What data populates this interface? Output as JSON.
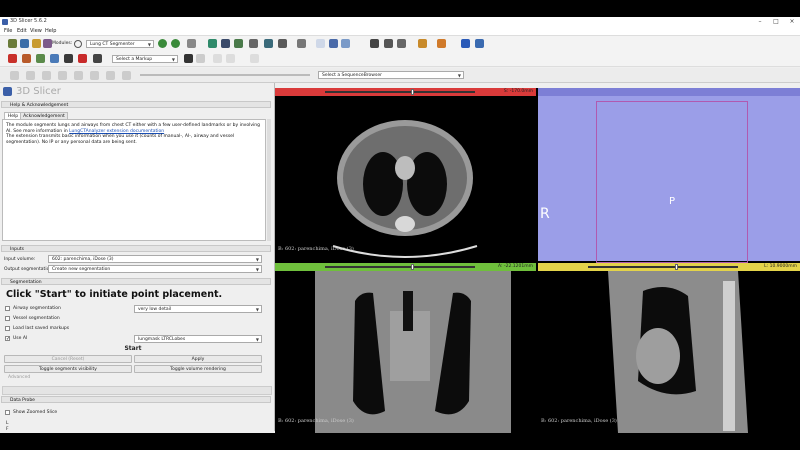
{
  "window": {
    "title": "3D Slicer 5.6.2"
  },
  "menu": [
    "File",
    "Edit",
    "View",
    "Help"
  ],
  "toolbar": {
    "modules_label": "Modules:",
    "module_selected": "Lung CT Segmenter",
    "markup_selected": "Select a Markup",
    "sequence_selected": "Select a SequenceBrowser"
  },
  "panel": {
    "logo_text": "3D Slicer",
    "help_section": "Help & Acknowledgement",
    "tabs": [
      "Help",
      "Acknowledgement"
    ],
    "help_text_1": "The module segments lungs and airways from chest CT either with a few user-defined landmarks or by involving AI. See more information in",
    "help_link": "LungCTAnalyzer extension documentation",
    "help_text_2": "The extension transmits basic information when you use it (counts of manual-, AI-, airway and vessel segmentation). No IP or any personal data are being sent.",
    "inputs_section": "Inputs",
    "input_volume_label": "Input volume:",
    "input_volume_value": "602: parenchima, iDose (3)",
    "output_seg_label": "Output segmentation:",
    "output_seg_value": "Create new segmentation",
    "segmentation_section": "Segmentation",
    "start_prompt": "Click \"Start\" to initiate point placement.",
    "airway_label": "Airway segmentation",
    "airway_value": "very low detail",
    "vessel_label": "Vessel segmentation",
    "load_last_label": "Load last saved markups",
    "use_ai_label": "Use AI",
    "ai_model_value": "lungmask LTRCLobes",
    "start_button": "Start",
    "cancel_button": "Cancel (Reset)",
    "apply_button": "Apply",
    "toggle_vis_button": "Toggle segments visibility",
    "toggle_render_button": "Toggle volume rendering",
    "advanced_label": "Advanced",
    "data_probe_section": "Data Probe",
    "show_zoomed_label": "Show Zoomed Slice",
    "probe_lines": [
      "L",
      "F",
      "B"
    ]
  },
  "views": {
    "red_annotation": "S: -170.0mm",
    "green_annotation": "A: -22.1201mm",
    "yellow_annotation": "L: 10.9000mm",
    "red_bottom_label": "B: 602: parenchima, iDose (3)",
    "green_bottom_label": "B: 602: parenchima, iDose (3)",
    "yellow_bottom_label": "B: 602: parenchima, iDose (3)",
    "threed_left_letter": "R",
    "threed_center_letter": "P"
  },
  "colors": {
    "red_bar": "#d93a3a",
    "green_bar": "#6fbf3c",
    "yellow_bar": "#e3d34a",
    "threed_bar": "#7d7fd6",
    "threed_bg": "#9b9ee8"
  }
}
